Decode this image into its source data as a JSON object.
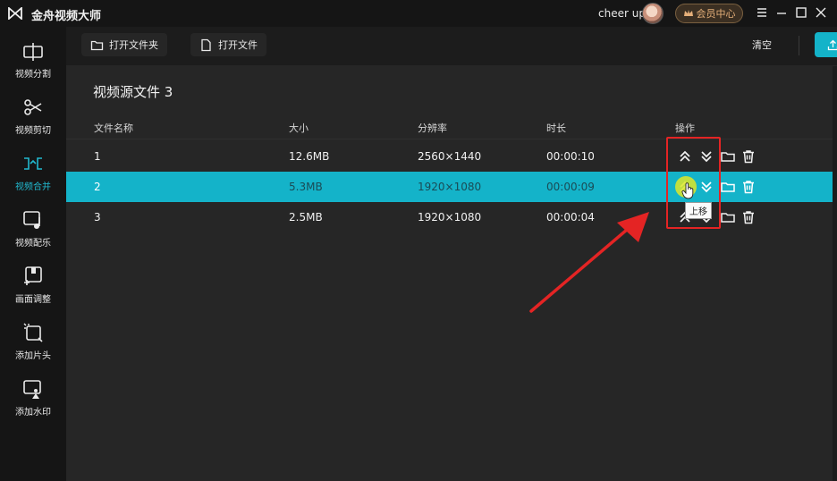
{
  "app": {
    "title": "金舟视频大师",
    "username": "cheer up",
    "vip_label": "会员中心",
    "accent_color": "#14b3c9"
  },
  "sidebar": {
    "items": [
      {
        "label": "视频分割",
        "icon": "split-icon"
      },
      {
        "label": "视频剪切",
        "icon": "scissors-icon"
      },
      {
        "label": "视频合并",
        "icon": "merge-icon",
        "active": true
      },
      {
        "label": "视频配乐",
        "icon": "music-icon"
      },
      {
        "label": "画面调整",
        "icon": "adjust-icon"
      },
      {
        "label": "添加片头",
        "icon": "intro-icon"
      },
      {
        "label": "添加水印",
        "icon": "watermark-icon"
      }
    ]
  },
  "toolbar": {
    "open_folder": "打开文件夹",
    "open_file": "打开文件",
    "clear": "清空",
    "export": "导出"
  },
  "panel": {
    "title": "视频源文件 3",
    "columns": [
      "文件名称",
      "大小",
      "分辨率",
      "时长",
      "操作"
    ],
    "rows": [
      {
        "name": "1",
        "size": "12.6MB",
        "resolution": "2560×1440",
        "duration": "00:00:10"
      },
      {
        "name": "2",
        "size": "5.3MB",
        "resolution": "1920×1080",
        "duration": "00:00:09",
        "selected": true
      },
      {
        "name": "3",
        "size": "2.5MB",
        "resolution": "1920×1080",
        "duration": "00:00:04"
      }
    ],
    "tooltip": "上移"
  }
}
